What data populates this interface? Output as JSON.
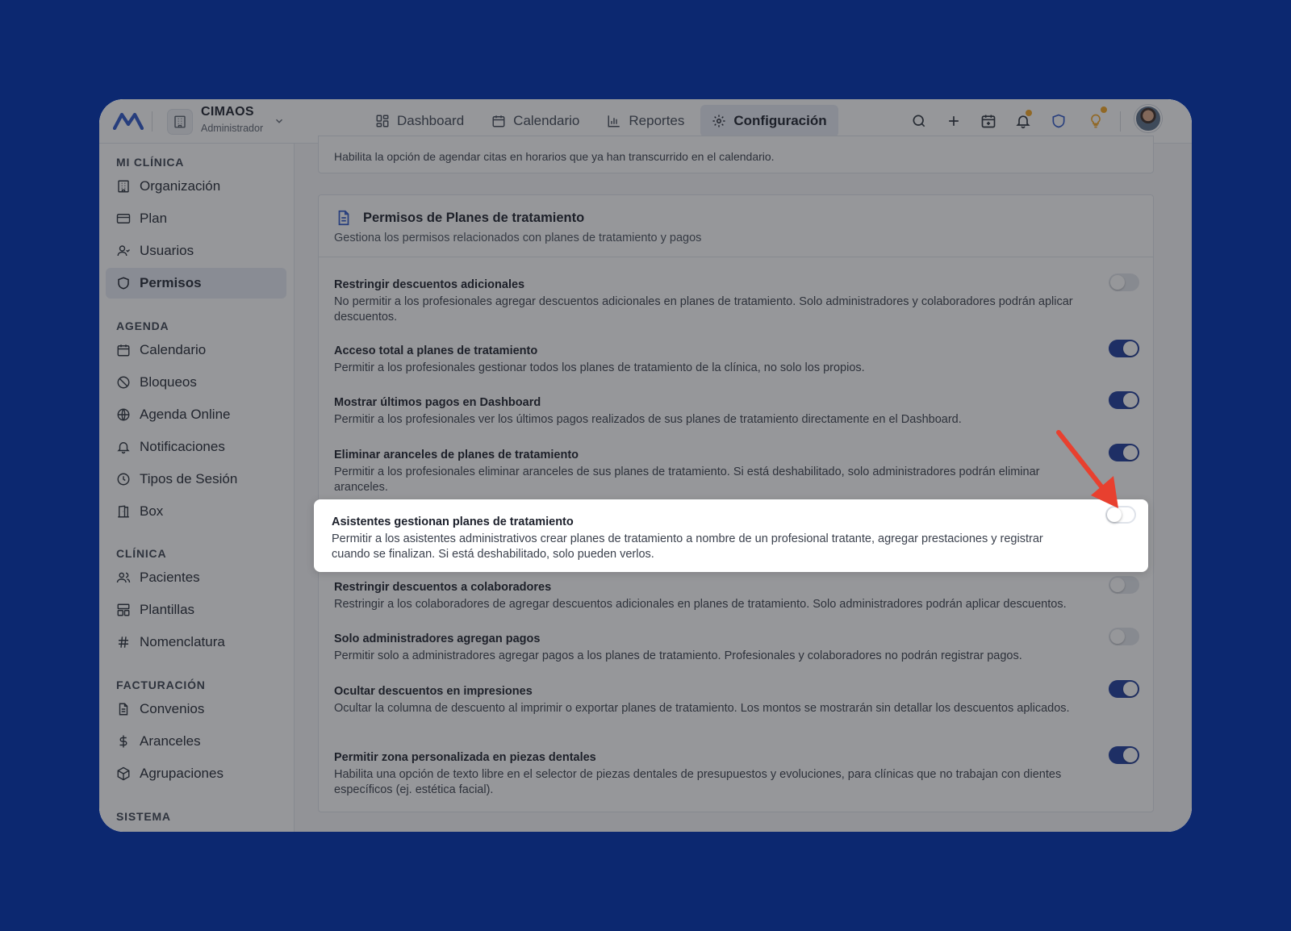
{
  "header": {
    "org_name": "CIMAOS",
    "org_role": "Administrador",
    "nav": [
      {
        "label": "Dashboard",
        "icon": "dashboard-icon"
      },
      {
        "label": "Calendario",
        "icon": "calendar-icon"
      },
      {
        "label": "Reportes",
        "icon": "bar-chart-icon"
      },
      {
        "label": "Configuración",
        "icon": "gear-icon",
        "active": true
      }
    ],
    "actions": [
      "search-icon",
      "plus-icon",
      "calendar-add-icon",
      "bell-icon",
      "shield-icon",
      "lightbulb-icon"
    ]
  },
  "sidebar": {
    "sections": [
      {
        "title": "MI CLÍNICA",
        "items": [
          {
            "label": "Organización",
            "icon": "building-icon"
          },
          {
            "label": "Plan",
            "icon": "credit-card-icon"
          },
          {
            "label": "Usuarios",
            "icon": "user-icon"
          },
          {
            "label": "Permisos",
            "icon": "shield-icon",
            "active": true
          }
        ]
      },
      {
        "title": "AGENDA",
        "items": [
          {
            "label": "Calendario",
            "icon": "calendar-icon"
          },
          {
            "label": "Bloqueos",
            "icon": "ban-icon"
          },
          {
            "label": "Agenda Online",
            "icon": "globe-icon"
          },
          {
            "label": "Notificaciones",
            "icon": "bell-icon"
          },
          {
            "label": "Tipos de Sesión",
            "icon": "clock-icon"
          },
          {
            "label": "Box",
            "icon": "door-icon"
          }
        ]
      },
      {
        "title": "CLÍNICA",
        "items": [
          {
            "label": "Pacientes",
            "icon": "users-icon"
          },
          {
            "label": "Plantillas",
            "icon": "template-icon"
          },
          {
            "label": "Nomenclatura",
            "icon": "hash-icon"
          }
        ]
      },
      {
        "title": "FACTURACIÓN",
        "items": [
          {
            "label": "Convenios",
            "icon": "document-icon"
          },
          {
            "label": "Aranceles",
            "icon": "dollar-icon"
          },
          {
            "label": "Agrupaciones",
            "icon": "package-icon"
          }
        ]
      },
      {
        "title": "SISTEMA",
        "items": []
      }
    ]
  },
  "main": {
    "top_card_text": "Habilita la opción de agendar citas en horarios que ya han transcurrido en el calendario.",
    "card": {
      "title": "Permisos de Planes de tratamiento",
      "subtitle": "Gestiona los permisos relacionados con planes de tratamiento y pagos",
      "settings": [
        {
          "title": "Restringir descuentos adicionales",
          "desc": "No permitir a los profesionales agregar descuentos adicionales en planes de tratamiento. Solo administradores y colaboradores podrán aplicar descuentos.",
          "enabled": false
        },
        {
          "title": "Acceso total a planes de tratamiento",
          "desc": "Permitir a los profesionales gestionar todos los planes de tratamiento de la clínica, no solo los propios.",
          "enabled": true
        },
        {
          "title": "Mostrar últimos pagos en Dashboard",
          "desc": "Permitir a los profesionales ver los últimos pagos realizados de sus planes de tratamiento directamente en el Dashboard.",
          "enabled": true
        },
        {
          "title": "Eliminar aranceles de planes de tratamiento",
          "desc": "Permitir a los profesionales eliminar aranceles de sus planes de tratamiento. Si está deshabilitado, solo administradores podrán eliminar aranceles.",
          "enabled": true
        },
        {
          "title": "Asistentes gestionan planes de tratamiento",
          "desc": "Permitir a los asistentes administrativos crear planes de tratamiento a nombre de un profesional tratante, agregar prestaciones y registrar cuando se finalizan. Si está deshabilitado, solo pueden verlos.",
          "enabled": false,
          "highlighted": true
        },
        {
          "title": "Restringir descuentos a colaboradores",
          "desc": "Restringir a los colaboradores de agregar descuentos adicionales en planes de tratamiento. Solo administradores podrán aplicar descuentos.",
          "enabled": false
        },
        {
          "title": "Solo administradores agregan pagos",
          "desc": "Permitir solo a administradores agregar pagos a los planes de tratamiento. Profesionales y colaboradores no podrán registrar pagos.",
          "enabled": false
        },
        {
          "title": "Ocultar descuentos en impresiones",
          "desc": "Ocultar la columna de descuento al imprimir o exportar planes de tratamiento. Los montos se mostrarán sin detallar los descuentos aplicados.",
          "enabled": true
        },
        {
          "title": "Permitir zona personalizada en piezas dentales",
          "desc": "Habilita una opción de texto libre en el selector de piezas dentales de presupuestos y evoluciones, para clínicas que no trabajan con dientes específicos (ej. estética facial).",
          "enabled": true
        }
      ]
    }
  },
  "colors": {
    "background": "#0c2870",
    "accent": "#1e3c9c",
    "arrow": "#e8402f",
    "badge": "#f6a623"
  }
}
